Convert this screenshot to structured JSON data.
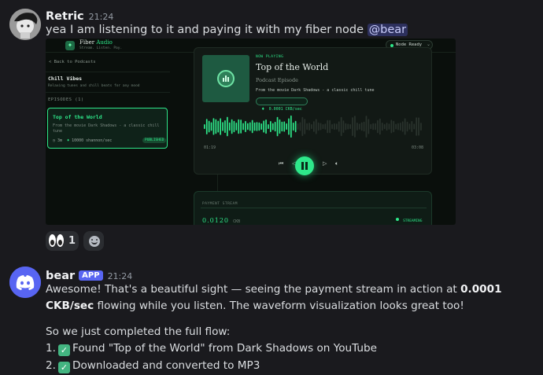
{
  "message1": {
    "username": "Retric",
    "timestamp": "21:24",
    "text": "yea I am listening to it and paying it with my fiber node",
    "mention": "@bear"
  },
  "embed": {
    "brand_name": "Fiber",
    "brand_accent": "Audio",
    "tagline": "Stream. Listen. Pay.",
    "node_status": "Node Ready",
    "back_link": "< Back to Podcasts",
    "channel_title": "Chill Vibes",
    "channel_desc": "Relaxing tunes and chill beats for any mood",
    "episodes_header": "EPISODES (1)",
    "episode": {
      "title": "Top of the World",
      "desc": "From the movie Dark Shadows - a classic chill tune",
      "duration": "3m",
      "price": "10000 shannon/sec",
      "badge": "PUBLISHED"
    },
    "player": {
      "now_playing": "NOW PLAYING",
      "title": "Top of the World",
      "subtitle": "Podcast Episode",
      "desc": "From the movie Dark Shadows - a classic chill tune",
      "rate": "0.0001 CKB/sec",
      "time_elapsed": "01:19",
      "time_total": "03:08",
      "progress": 0.42
    },
    "stream": {
      "label": "PAYMENT STREAM",
      "amount": "0.0120",
      "unit": "CKB",
      "status": "STREAMING"
    }
  },
  "reactions": [
    {
      "emoji": "👀",
      "count": "1"
    }
  ],
  "message2": {
    "username": "bear",
    "badge": "APP",
    "timestamp": "21:24",
    "p1_a": "Awesome! That's a beautiful sight — seeing the payment stream in action at",
    "p1_bold": "0.0001 CKB/sec",
    "p1_b": "flowing while you listen. The waveform visualization looks great too!",
    "p2": "So we just completed the full flow:",
    "items": [
      {
        "num": "1.",
        "text": "Found \"Top of the World\" from Dark Shadows on YouTube"
      },
      {
        "num": "2.",
        "text": "Downloaded and converted to MP3"
      }
    ]
  },
  "colors": {
    "accent_green": "#2ee88a",
    "discord_blurple": "#5865f2",
    "mention_bg": "#3c4270"
  }
}
